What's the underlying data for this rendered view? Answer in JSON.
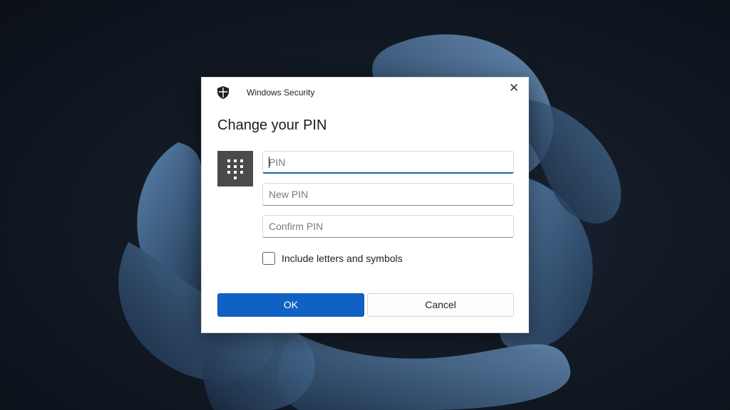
{
  "window": {
    "app_title": "Windows Security",
    "close_glyph": "✕"
  },
  "dialog": {
    "heading": "Change your PIN",
    "keypad_icon": "keypad-icon",
    "fields": {
      "pin_placeholder": "PIN",
      "new_pin_placeholder": "New PIN",
      "confirm_pin_placeholder": "Confirm PIN"
    },
    "checkbox": {
      "label": "Include letters and symbols",
      "checked": false
    },
    "buttons": {
      "ok_label": "OK",
      "cancel_label": "Cancel"
    }
  },
  "colors": {
    "accent": "#0f62c4",
    "keypad_tile": "#4a4a4a",
    "focus_underline": "#1f5fa8"
  }
}
